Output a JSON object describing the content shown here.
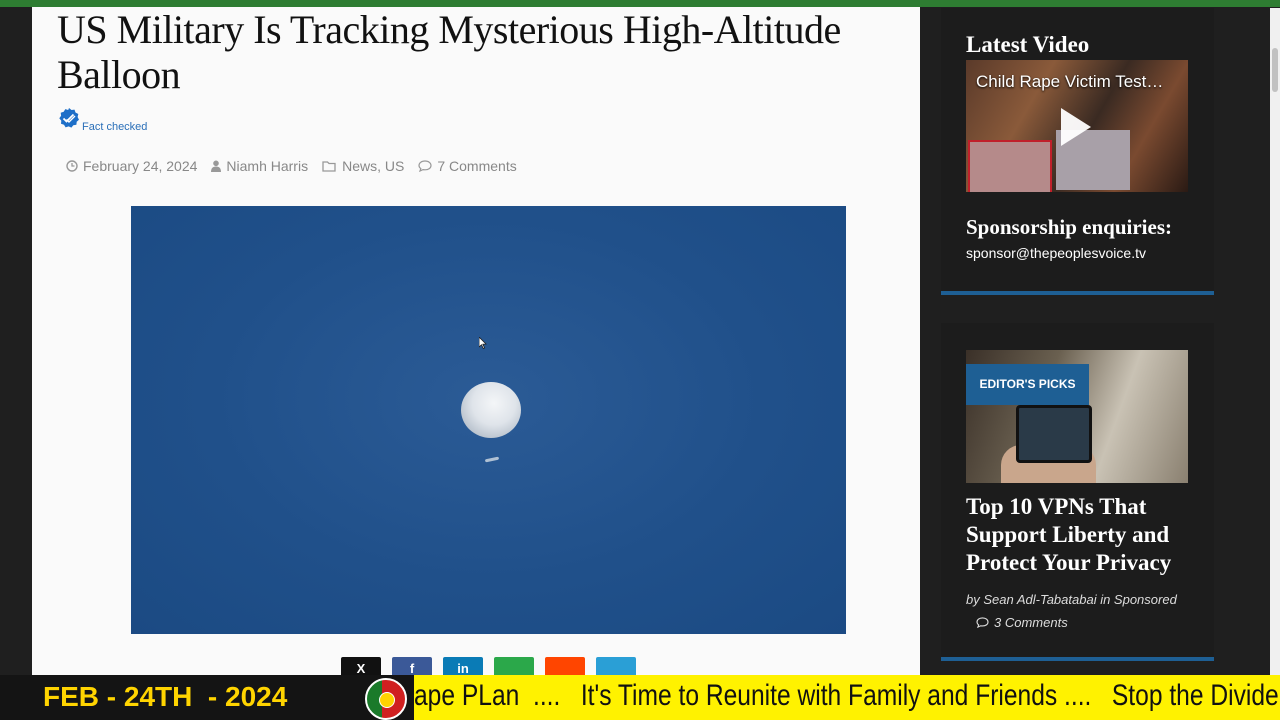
{
  "article": {
    "title": "US Military Is Tracking Mysterious High-Altitude Balloon",
    "fact_checked": "Fact checked",
    "date": "February 24, 2024",
    "author": "Niamh Harris",
    "category_1": "News",
    "category_sep": ",",
    "category_2": "US",
    "comments": "7 Comments",
    "share_buttons": [
      {
        "icon": "x-icon",
        "glyph": "X",
        "color": "#111111"
      },
      {
        "icon": "facebook-icon",
        "glyph": "f",
        "color": "#3b5998"
      },
      {
        "icon": "linkedin-icon",
        "glyph": "in",
        "color": "#0a7bb6"
      },
      {
        "icon": "email-icon",
        "glyph": "",
        "color": "#2ba84a"
      },
      {
        "icon": "reddit-icon",
        "glyph": "",
        "color": "#ff4500"
      },
      {
        "icon": "telegram-icon",
        "glyph": "",
        "color": "#2a9fd6"
      }
    ]
  },
  "sidebar": {
    "latest_video_heading": "Latest Video",
    "video_title": "Child Rape Victim Test…",
    "sponsorship_heading": "Sponsorship enquiries:",
    "sponsorship_email": "sponsor@thepeoplesvoice.tv",
    "editors_picks_badge": "EDITOR'S PICKS",
    "pick_title": "Top 10 VPNs That Support Liberty and Protect Your Privacy",
    "pick_byline": "by Sean Adl-Tabatabai in Sponsored",
    "pick_comments": "3 Comments"
  },
  "ticker": {
    "date": "FEB - 24TH  - 2024",
    "text": "ape PLan  ....   It's Time to Reunite with Family and Friends ....   Stop the Divide"
  },
  "colors": {
    "accent_blue": "#1e5f94",
    "ticker_yellow": "#fff200",
    "ticker_date": "#ffd400",
    "top_strip": "#2e7d32"
  }
}
